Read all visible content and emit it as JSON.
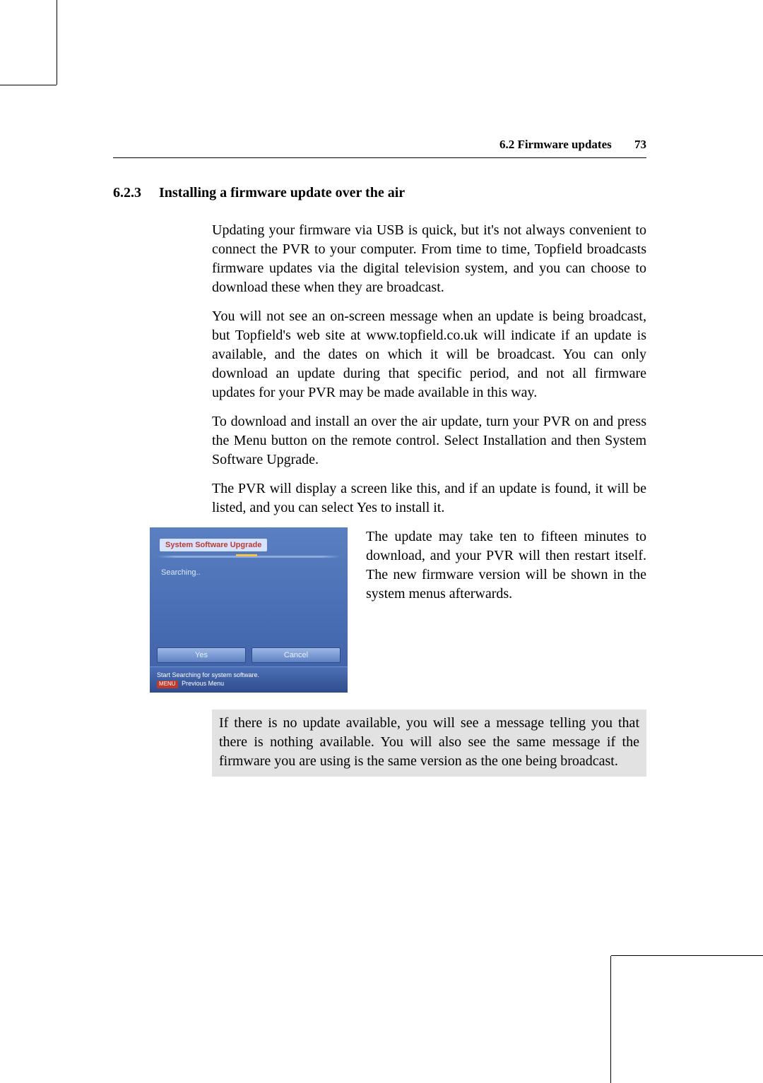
{
  "header": {
    "section": "6.2 Firmware updates",
    "page": "73"
  },
  "heading": {
    "number": "6.2.3",
    "title": "Installing a firmware update over the air"
  },
  "paragraphs": {
    "p1": "Updating your firmware via USB is quick, but it's not always convenient to connect the PVR to your computer. From time to time, Topfield broadcasts firmware updates via the digital television system, and you can choose to download these when they are broadcast.",
    "p2": "You will not see an on-screen message when an update is being broadcast, but Topfield's web site at www.topfield.co.uk will indicate if an update is available, and the dates on which it will be broadcast. You can only download an update during that specific period, and not all firmware updates for your PVR may be made available in this way.",
    "p3": "To download and install an over the air update, turn your PVR on and press the Menu button on the remote control. Select Installation and then System Software Upgrade.",
    "p4": "The PVR will display a screen like this, and if an update is found, it will be listed, and you can select Yes to install it.",
    "caption": "The update may take ten to fifteen minutes to download, and your PVR will then restart itself. The new firmware version will be shown in the system menus afterwards.",
    "note": "If there is no update available, you will see a message telling you that there is nothing available. You will also see the same message if the firmware you are using is the same version as the one being broadcast."
  },
  "pvr": {
    "title": "System Software Upgrade",
    "status": "Searching..",
    "yes": "Yes",
    "cancel": "Cancel",
    "hint1": "Start Searching for system software.",
    "menu_label": "MENU",
    "hint2": "Previous Menu"
  }
}
